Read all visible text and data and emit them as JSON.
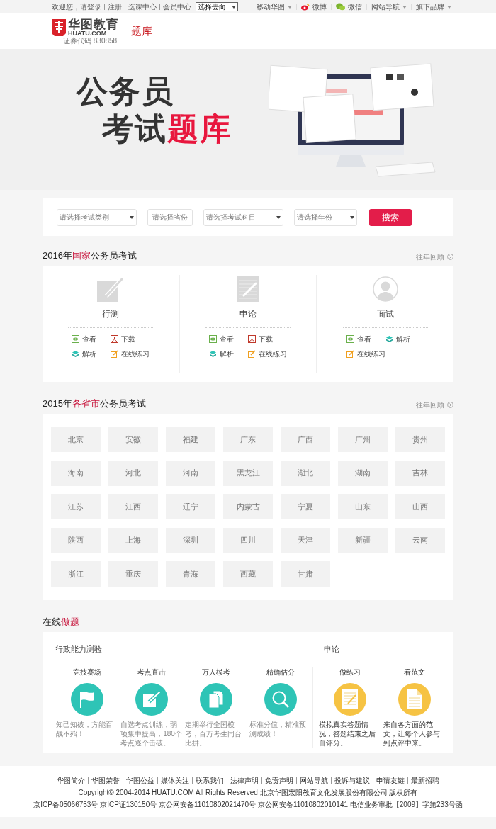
{
  "top_bar": {
    "left_links": [
      {
        "label": "欢迎您，请登录"
      },
      {
        "label": "注册"
      },
      {
        "label": "选课中心"
      },
      {
        "label": "会员中心"
      }
    ],
    "direction_select": {
      "value": "选择去向"
    },
    "right_links": [
      {
        "label": "移动华图",
        "kind": "dropdown"
      },
      {
        "label": "微博",
        "kind": "weibo"
      },
      {
        "label": "微信",
        "kind": "wechat"
      },
      {
        "label": "网站导航",
        "kind": "dropdown"
      },
      {
        "label": "旗下品牌",
        "kind": "dropdown"
      }
    ]
  },
  "header": {
    "logo_name": "华图教育",
    "logo_domain": "HUATU.COM",
    "stock_code": "证券代码 830858",
    "section": "题库"
  },
  "banner": {
    "line_1": [
      {
        "text": "公务员",
        "highlight": false
      }
    ],
    "line_2": [
      {
        "text": "考试",
        "highlight": false
      },
      {
        "text": "题库",
        "highlight": true
      }
    ]
  },
  "search": {
    "fields": [
      {
        "placeholder": "请选择考试类别",
        "kind": "select"
      },
      {
        "placeholder": "请选择省份",
        "kind": "button"
      },
      {
        "placeholder": "请选择考试科目",
        "kind": "select"
      },
      {
        "placeholder": "请选择年份",
        "kind": "select"
      }
    ],
    "button": "搜索"
  },
  "national": {
    "heading": [
      {
        "text": "2016年",
        "highlight": false
      },
      {
        "text": "国家",
        "highlight": true
      },
      {
        "text": "公务员考试",
        "highlight": false
      }
    ],
    "history_link": "往年回顾",
    "exams": [
      {
        "title": "行测",
        "kind": "edit",
        "links": [
          {
            "label": "查看",
            "kind": "view"
          },
          {
            "label": "下载",
            "kind": "download"
          },
          {
            "label": "解析",
            "kind": "analysis"
          },
          {
            "label": "在线练习",
            "kind": "practice"
          }
        ]
      },
      {
        "title": "申论",
        "kind": "paper",
        "links": [
          {
            "label": "查看",
            "kind": "view"
          },
          {
            "label": "下载",
            "kind": "download"
          },
          {
            "label": "解析",
            "kind": "analysis"
          },
          {
            "label": "在线练习",
            "kind": "practice"
          }
        ]
      },
      {
        "title": "面试",
        "kind": "person",
        "links": [
          {
            "label": "查看",
            "kind": "view"
          },
          {
            "label": "解析",
            "kind": "analysis"
          },
          {
            "label": "在线练习",
            "kind": "practice"
          }
        ]
      }
    ]
  },
  "provincial": {
    "heading": [
      {
        "text": "2015年",
        "highlight": false
      },
      {
        "text": "各省市",
        "highlight": true
      },
      {
        "text": "公务员考试",
        "highlight": false
      }
    ],
    "history_link": "往年回顾",
    "regions": [
      "北京",
      "安徽",
      "福建",
      "广东",
      "广西",
      "广州",
      "贵州",
      "海南",
      "河北",
      "河南",
      "黑龙江",
      "湖北",
      "湖南",
      "吉林",
      "江苏",
      "江西",
      "辽宁",
      "内蒙古",
      "宁夏",
      "山东",
      "山西",
      "陕西",
      "上海",
      "深圳",
      "四川",
      "天津",
      "新疆",
      "云南",
      "浙江",
      "重庆",
      "青海",
      "西藏",
      "甘肃"
    ]
  },
  "online": {
    "heading": [
      {
        "text": "在线",
        "highlight": false
      },
      {
        "text": "做题",
        "highlight": true
      }
    ],
    "groups": [
      {
        "title": "行政能力测验",
        "color": "#2ec4b6",
        "items": [
          {
            "title": "竞技赛场",
            "kind": "flag",
            "description": "知己知彼，方能百战不殆！"
          },
          {
            "title": "考点直击",
            "kind": "edit",
            "description": "自选考点训练，弱项集中提高，180个考点逐个击破。"
          },
          {
            "title": "万人模考",
            "kind": "files",
            "description": "定期举行全国模考，百万考生同台比拼。"
          },
          {
            "title": "精确估分",
            "kind": "search",
            "description": "标准分值，精准预测成绩！"
          }
        ]
      },
      {
        "title": "申论",
        "color": "#f6c343",
        "items": [
          {
            "title": "做练习",
            "kind": "paper",
            "description": "模拟真实答题情况，答题结束之后自评分。"
          },
          {
            "title": "看范文",
            "kind": "document",
            "description": "来自各方面的范文，让每个人参与到点评中来。"
          }
        ]
      }
    ]
  },
  "footer": {
    "links": [
      "华图简介",
      "华图荣誉",
      "华图公益",
      "媒体关注",
      "联系我们",
      "法律声明",
      "免责声明",
      "网站导航",
      "投诉与建议",
      "申请友链",
      "最新招聘"
    ],
    "copyright": "Copyright© 2004-2014 HUATU.COM All Rights Reserved 北京华图宏阳教育文化发展股份有限公司 版权所有",
    "licenses": "京ICP备05066753号 京ICP证130150号 京公网安备11010802021470号 京公网安备11010802010141 电信业务审批【2009】字第233号函"
  }
}
